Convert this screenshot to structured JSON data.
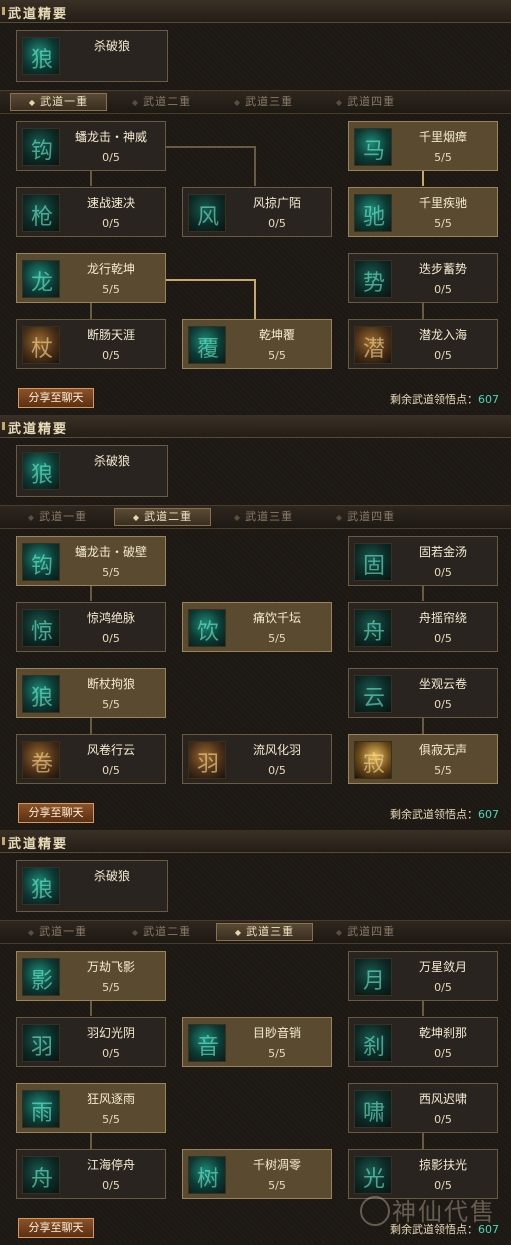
{
  "essence_title": "武道精要",
  "tabs": [
    "武道一重",
    "武道二重",
    "武道三重",
    "武道四重"
  ],
  "share_label": "分享至聊天",
  "remaining_label": "剩余武道领悟点：",
  "remaining_points": "607",
  "watermark_text": "神仙代售",
  "sections": [
    {
      "essence": "杀破狼",
      "active_tab": 0,
      "nodes": [
        {
          "name": "蟠龙击・神威",
          "level": "0/5"
        },
        {
          "name": "千里烟瘴",
          "level": "5/5"
        },
        {
          "name": "速战速决",
          "level": "0/5"
        },
        {
          "name": "风掠广陌",
          "level": "0/5"
        },
        {
          "name": "千里疾驰",
          "level": "5/5"
        },
        {
          "name": "龙行乾坤",
          "level": "5/5"
        },
        {
          "name": "迭步蓄势",
          "level": "0/5"
        },
        {
          "name": "断肠天涯",
          "level": "0/5"
        },
        {
          "name": "乾坤覆",
          "level": "5/5"
        },
        {
          "name": "潜龙入海",
          "level": "0/5"
        }
      ]
    },
    {
      "essence": "杀破狼",
      "active_tab": 1,
      "nodes": [
        {
          "name": "蟠龙击・破壁",
          "level": "5/5"
        },
        {
          "name": "固若金汤",
          "level": "0/5"
        },
        {
          "name": "惊鸿绝脉",
          "level": "0/5"
        },
        {
          "name": "痛饮千坛",
          "level": "5/5"
        },
        {
          "name": "舟摇帘绕",
          "level": "0/5"
        },
        {
          "name": "断杖拘狼",
          "level": "5/5"
        },
        {
          "name": "坐观云卷",
          "level": "0/5"
        },
        {
          "name": "风卷行云",
          "level": "0/5"
        },
        {
          "name": "流风化羽",
          "level": "0/5"
        },
        {
          "name": "俱寂无声",
          "level": "5/5"
        }
      ]
    },
    {
      "essence": "杀破狼",
      "active_tab": 2,
      "nodes": [
        {
          "name": "万劫飞影",
          "level": "5/5"
        },
        {
          "name": "万星敛月",
          "level": "0/5"
        },
        {
          "name": "羽幻光阴",
          "level": "0/5"
        },
        {
          "name": "目眇音销",
          "level": "5/5"
        },
        {
          "name": "乾坤刹那",
          "level": "0/5"
        },
        {
          "name": "狂风逐雨",
          "level": "5/5"
        },
        {
          "name": "西风迟啸",
          "level": "0/5"
        },
        {
          "name": "江海停舟",
          "level": "0/5"
        },
        {
          "name": "千树凋零",
          "level": "5/5"
        },
        {
          "name": "掠影扶光",
          "level": "0/5"
        }
      ]
    }
  ]
}
